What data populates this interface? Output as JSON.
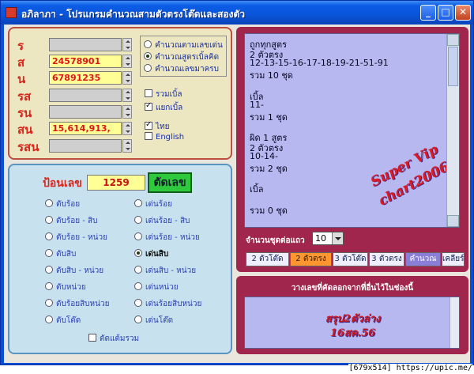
{
  "window": {
    "title": "อภิลาภา - โปรแกรมคำนวณสามตัวตรงโต๊ดและสองตัว",
    "min_symbol": "_",
    "max_symbol": "□",
    "close_symbol": "✕"
  },
  "top_left": {
    "rows": [
      {
        "label": "ร",
        "value": ""
      },
      {
        "label": "ส",
        "value": "24578901"
      },
      {
        "label": "น",
        "value": "67891235"
      },
      {
        "label": "รส",
        "value": ""
      },
      {
        "label": "รน",
        "value": ""
      },
      {
        "label": "สน",
        "value": "15,614,913,"
      },
      {
        "label": "รสน",
        "value": ""
      }
    ],
    "modes": [
      {
        "label": "คำนวณตามเลขเด่น",
        "selected": false
      },
      {
        "label": "คำนวณสูตรเบิ้ลคิด",
        "selected": true
      },
      {
        "label": "คำนวณเลขมาครบ",
        "selected": false
      }
    ],
    "checks": [
      {
        "label": "รวมเบิ้ล",
        "checked": false
      },
      {
        "label": "แยกเบิ้ล",
        "checked": true
      },
      {
        "label": "ไทย",
        "checked": true
      },
      {
        "label": "English",
        "checked": false
      }
    ]
  },
  "bottom_left": {
    "input_label": "ป้อนเลข",
    "input_value": "1259",
    "cut_button": "ตัดเลข",
    "left_options": [
      {
        "label": "ตับร้อย",
        "selected": false
      },
      {
        "label": "ตับร้อย - สิบ",
        "selected": false
      },
      {
        "label": "ตับร้อย - หน่วย",
        "selected": false
      },
      {
        "label": "ตับสิบ",
        "selected": false
      },
      {
        "label": "ตับสิบ - หน่วย",
        "selected": false
      },
      {
        "label": "ตับหน่วย",
        "selected": false
      },
      {
        "label": "ตับร้อยสิบหน่วย",
        "selected": false
      },
      {
        "label": "ตับโต๊ด",
        "selected": false
      }
    ],
    "right_options": [
      {
        "label": "เด่นร้อย",
        "selected": false
      },
      {
        "label": "เด่นร้อย - สิบ",
        "selected": false
      },
      {
        "label": "เด่นร้อย - หน่วย",
        "selected": false
      },
      {
        "label": "เด่นสิบ",
        "selected": true
      },
      {
        "label": "เด่นสิบ - หน่วย",
        "selected": false
      },
      {
        "label": "เด่นหน่วย",
        "selected": false
      },
      {
        "label": "เด่นร้อยสิบหน่วย",
        "selected": false
      },
      {
        "label": "เด่นโต๊ด",
        "selected": false
      }
    ],
    "sum_check": "ตัดแต้มรวม"
  },
  "results": {
    "lines": [
      "ถูกทุกสูตร",
      "2 ตัวตรง",
      "12-13-15-16-17-18-19-21-51-91",
      "รวม 10 ชุด",
      "",
      "เบิ้ล",
      "11-",
      "รวม 1 ชุด",
      "",
      "ผิด 1 สูตร",
      "2 ตัวตรง",
      "10-14-",
      "รวม 2 ชุด",
      "",
      "เบิ้ล",
      "",
      "รวม 0 ชุด"
    ],
    "watermark_line1": "Super Vip",
    "watermark_line2": "chart2006",
    "rows_label": "จำนวนชุดต่อแถว",
    "rows_value": "10",
    "tabs": [
      {
        "label": "2 ตัวโต๊ด",
        "color": "#eeeeff",
        "text": "#102050"
      },
      {
        "label": "2 ตัวตรง",
        "color": "#ff9630",
        "text": "#2a1a00"
      },
      {
        "label": "3 ตัวโต๊ด",
        "color": "#eeeeff",
        "text": "#102050"
      },
      {
        "label": "3 ตัวตรง",
        "color": "#eeeeff",
        "text": "#102050"
      },
      {
        "label": "คำนวณ",
        "color": "#8a7fd6",
        "text": "#ffffff"
      },
      {
        "label": "เคลียร์",
        "color": "#eeeeff",
        "text": "#102050"
      }
    ]
  },
  "notes": {
    "title": "วางเลขที่คัดลอกจากที่อื่นไว้ในช่องนี้",
    "line1": "สรุป2ตัวล่าง",
    "line2": "16สค.56"
  },
  "caption": "[679x514] https://upic.me/"
}
